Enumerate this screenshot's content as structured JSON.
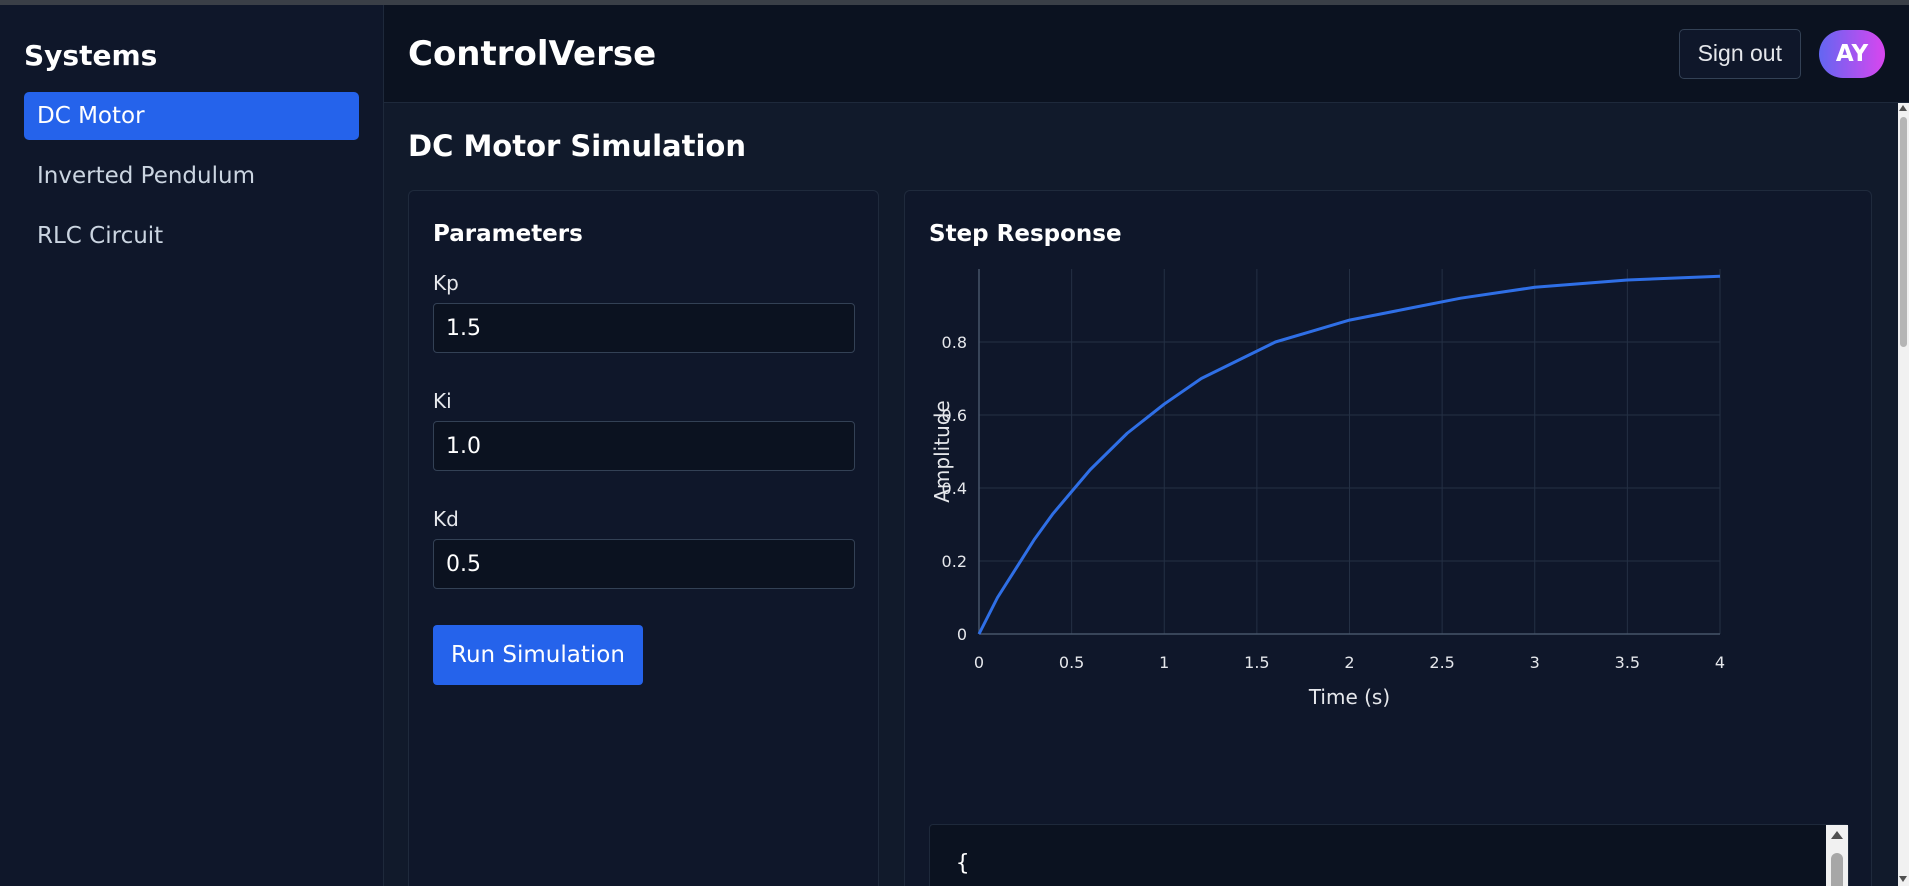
{
  "sidebar": {
    "title": "Systems",
    "items": [
      {
        "label": "DC Motor",
        "active": true
      },
      {
        "label": "Inverted Pendulum",
        "active": false
      },
      {
        "label": "RLC Circuit",
        "active": false
      }
    ]
  },
  "header": {
    "brand": "ControlVerse",
    "signout_label": "Sign out",
    "avatar_initials": "AY"
  },
  "main": {
    "page_title": "DC Motor Simulation",
    "params": {
      "title": "Parameters",
      "fields": [
        {
          "label": "Kp",
          "value": "1.5"
        },
        {
          "label": "Ki",
          "value": "1.0"
        },
        {
          "label": "Kd",
          "value": "0.5"
        }
      ],
      "run_label": "Run Simulation"
    },
    "response": {
      "title": "Step Response",
      "code_preview": "{"
    }
  },
  "colors": {
    "accent": "#2563eb",
    "line": "#2f6fe6",
    "background": "#0f172a"
  },
  "chart_data": {
    "type": "line",
    "title": "",
    "xlabel": "Time (s)",
    "ylabel": "Amplitude",
    "xlim": [
      0,
      4
    ],
    "ylim": [
      0,
      1
    ],
    "xticks": [
      "0",
      "0.5",
      "1",
      "1.5",
      "2",
      "2.5",
      "3",
      "3.5",
      "4"
    ],
    "yticks": [
      "0",
      "0.2",
      "0.4",
      "0.6",
      "0.8"
    ],
    "grid": true,
    "series": [
      {
        "name": "",
        "x": [
          0,
          0.1,
          0.2,
          0.3,
          0.4,
          0.5,
          0.6,
          0.8,
          1.0,
          1.2,
          1.4,
          1.6,
          1.8,
          2.0,
          2.3,
          2.6,
          3.0,
          3.5,
          4.0
        ],
        "y": [
          0,
          0.1,
          0.18,
          0.26,
          0.33,
          0.39,
          0.45,
          0.55,
          0.63,
          0.7,
          0.75,
          0.8,
          0.83,
          0.86,
          0.89,
          0.92,
          0.95,
          0.97,
          0.98
        ]
      }
    ]
  }
}
